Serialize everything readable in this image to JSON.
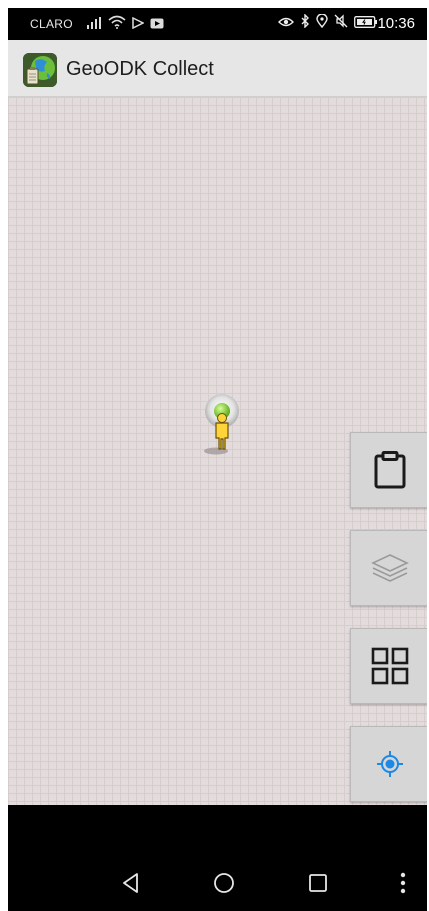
{
  "status_bar": {
    "carrier": "CLARO",
    "time": "10:36",
    "left_icons": [
      "signal-icon",
      "wifi-icon",
      "media-icon",
      "youtube-icon"
    ],
    "right_icons": [
      "eye-icon",
      "bluetooth-icon",
      "location-icon",
      "mute-icon",
      "battery-icon"
    ]
  },
  "app_bar": {
    "title": "GeoODK Collect",
    "logo": "geoodk-logo-icon"
  },
  "map": {
    "marker": "person-location-marker-icon",
    "buttons": [
      {
        "name": "clipboard-button",
        "icon": "clipboard-icon",
        "enabled": true
      },
      {
        "name": "layers-button",
        "icon": "layers-icon",
        "enabled": false
      },
      {
        "name": "grid-button",
        "icon": "grid-icon",
        "enabled": true
      },
      {
        "name": "my-location-button",
        "icon": "crosshair-location-icon",
        "enabled": true
      }
    ],
    "colors": {
      "background": "#e4dcdc",
      "gridline": "#d6cdcd",
      "button_bg": "#d6d6d6",
      "location_accent": "#1e88e5"
    }
  },
  "nav_bar": {
    "buttons": [
      "back-icon",
      "home-icon",
      "recents-icon",
      "menu-dots-icon"
    ]
  }
}
